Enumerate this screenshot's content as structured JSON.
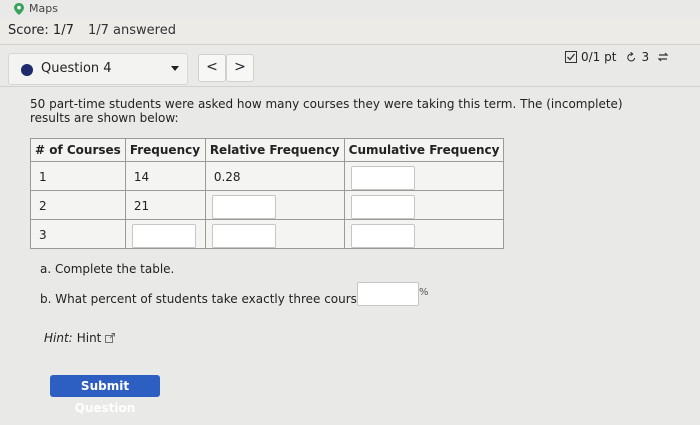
{
  "top": {
    "app_label": "Maps"
  },
  "score_bar": {
    "score": "Score: 1/7",
    "answered": "1/7 answered"
  },
  "question_selector": {
    "label": "Question 4"
  },
  "nav": {
    "prev": "<",
    "next": ">"
  },
  "points": {
    "text": "0/1 pt",
    "retries": "3"
  },
  "question": {
    "text": "50 part-time students were asked how many courses they were taking this term. The (incomplete) results are shown below:"
  },
  "table": {
    "headers": [
      "# of Courses",
      "Frequency",
      "Relative Frequency",
      "Cumulative Frequency"
    ],
    "rows": [
      {
        "courses": "1",
        "frequency": "14",
        "relative": "0.28"
      },
      {
        "courses": "2",
        "frequency": "21"
      },
      {
        "courses": "3"
      }
    ]
  },
  "parts": {
    "a": "a. Complete the table.",
    "b": "b. What percent of students take exactly three courses?",
    "b_unit": "%"
  },
  "hint": {
    "label": "Hint:",
    "link": "Hint"
  },
  "submit": {
    "label": "Submit Question"
  },
  "colors": {
    "accent": "#2d5ec2",
    "question_dot": "#1d2a6b"
  }
}
